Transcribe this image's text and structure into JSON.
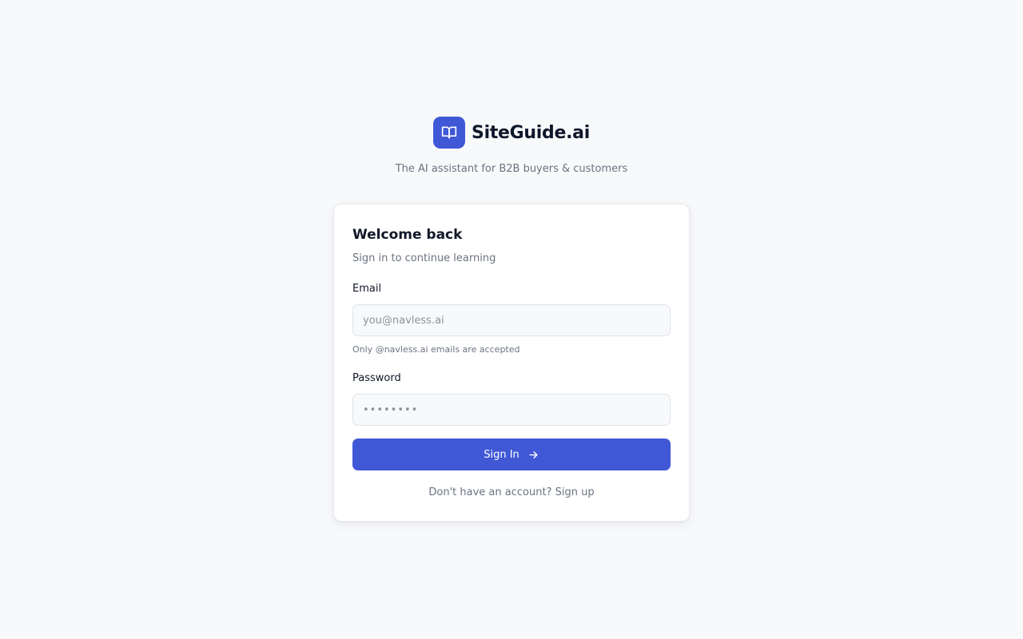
{
  "brand": {
    "name": "SiteGuide.ai",
    "logo_icon": "book-open-icon",
    "tagline": "The AI assistant for B2B buyers & customers"
  },
  "card": {
    "title": "Welcome back",
    "subtitle": "Sign in to continue learning"
  },
  "email": {
    "label": "Email",
    "placeholder": "you@navless.ai",
    "value": "",
    "hint": "Only @navless.ai emails are accepted"
  },
  "password": {
    "label": "Password",
    "placeholder": "••••••••",
    "value": ""
  },
  "submit": {
    "label": "Sign In",
    "icon": "arrow-right-icon"
  },
  "signup": {
    "prompt": "Don't have an account?",
    "link_label": "Sign up"
  },
  "colors": {
    "accent": "#4058d6",
    "background": "#f8f9fb",
    "muted_text": "#6b7280"
  }
}
